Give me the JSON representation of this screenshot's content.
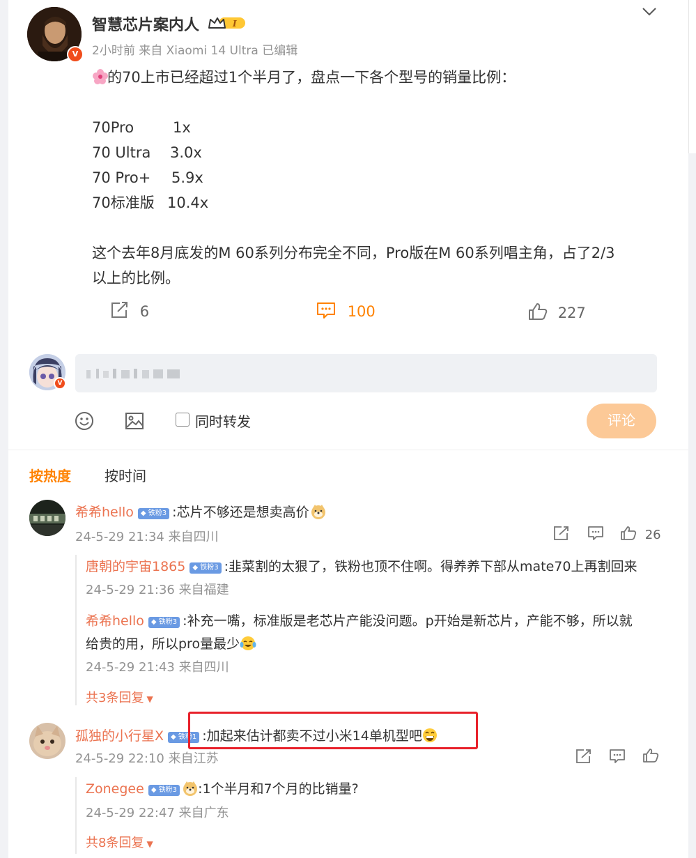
{
  "post": {
    "author": "智慧芯片案内人",
    "time": "2小时前",
    "source": "来自 Xiaomi 14 Ultra",
    "edited": "已编辑",
    "v_badge": "V",
    "intro": "的70上市已经超过1个半月了，盘点一下各个型号的销量比例：",
    "models": [
      {
        "name": "70Pro",
        "ratio": "1x"
      },
      {
        "name": "70 Ultra",
        "ratio": "3.0x"
      },
      {
        "name": "70 Pro+",
        "ratio": "5.9x"
      },
      {
        "name": "70标准版",
        "ratio": "10.4x"
      }
    ],
    "closing_line1": "这个去年8月底发的M 60系列分布完全不同，Pro版在M 60系列唱主角，占了2/3",
    "closing_line2": "以上的比例。",
    "repost_count": "6",
    "comment_count": "100",
    "like_count": "227"
  },
  "compose": {
    "sync_repost_label": "同时转发",
    "submit_label": "评论"
  },
  "sort": {
    "hot": "按热度",
    "time": "按时间"
  },
  "comments": [
    {
      "user": "希希hello",
      "badge": "铁粉3",
      "text": ":芯片不够还是想卖高价",
      "time": "24-5-29 21:34 来自四川",
      "likes": "26",
      "replies": [
        {
          "user": "唐朝的宇宙1865",
          "badge": "铁粉3",
          "text": ":韭菜割的太狠了，铁粉也顶不住啊。得养养下部从mate70上再割回来",
          "time": "24-5-29 21:36 来自福建"
        },
        {
          "user": "希希hello",
          "badge": "铁粉3",
          "text_line1": ":补充一嘴，标准版是老芯片产能没问题。p开始是新芯片，产能不够，所以就",
          "text_line2": "给贵的用，所以pro量最少",
          "time": "24-5-29 21:43 来自四川"
        }
      ],
      "more_replies": "共3条回复"
    },
    {
      "user": "孤独的小行星X",
      "badge": "铁粉1",
      "text": ":加起来估计都卖不过小米14单机型吧",
      "time": "24-5-29 22:10 来自江苏",
      "replies": [
        {
          "user": "Zonegee",
          "badge": "铁粉3",
          "text": ":1个半月和7个月的比销量?",
          "time": "24-5-29 22:47 来自广东"
        }
      ],
      "more_replies": "共8条回复"
    }
  ],
  "colors": {
    "accent": "#ff8200",
    "username": "#eb7350",
    "submit_disabled": "#fcc997",
    "highlight_box": "#e8212b"
  }
}
